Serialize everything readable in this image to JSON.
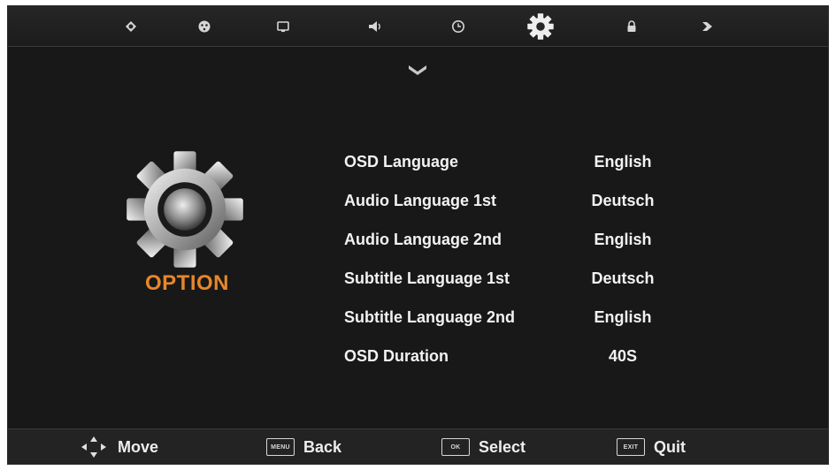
{
  "topbar": {
    "tabs": [
      {
        "id": "picture",
        "icon": "picture-icon"
      },
      {
        "id": "sound-mode",
        "icon": "palette-icon"
      },
      {
        "id": "channel",
        "icon": "screen-icon"
      },
      {
        "id": "sound",
        "icon": "speaker-icon"
      },
      {
        "id": "time",
        "icon": "clock-icon"
      },
      {
        "id": "option",
        "icon": "gear-icon",
        "selected": true
      },
      {
        "id": "lock",
        "icon": "lock-icon"
      },
      {
        "id": "input",
        "icon": "input-icon"
      }
    ],
    "scroll_indicator_icon": "chevron-down-icon"
  },
  "page": {
    "title": "OPTION",
    "icon": "gear-icon",
    "title_color": "#e8862a"
  },
  "menu": {
    "items": [
      {
        "label": "OSD Language",
        "value": "English"
      },
      {
        "label": "Audio Language 1st",
        "value": "Deutsch"
      },
      {
        "label": "Audio Language 2nd",
        "value": "English"
      },
      {
        "label": "Subtitle Language 1st",
        "value": "Deutsch"
      },
      {
        "label": "Subtitle Language 2nd",
        "value": "English"
      },
      {
        "label": "OSD Duration",
        "value": "40S"
      }
    ]
  },
  "footer": {
    "move": {
      "label": "Move",
      "icon": "arrows-icon"
    },
    "back": {
      "label": "Back",
      "key": "MENU"
    },
    "select": {
      "label": "Select",
      "key": "OK"
    },
    "quit": {
      "label": "Quit",
      "key": "EXIT"
    }
  }
}
